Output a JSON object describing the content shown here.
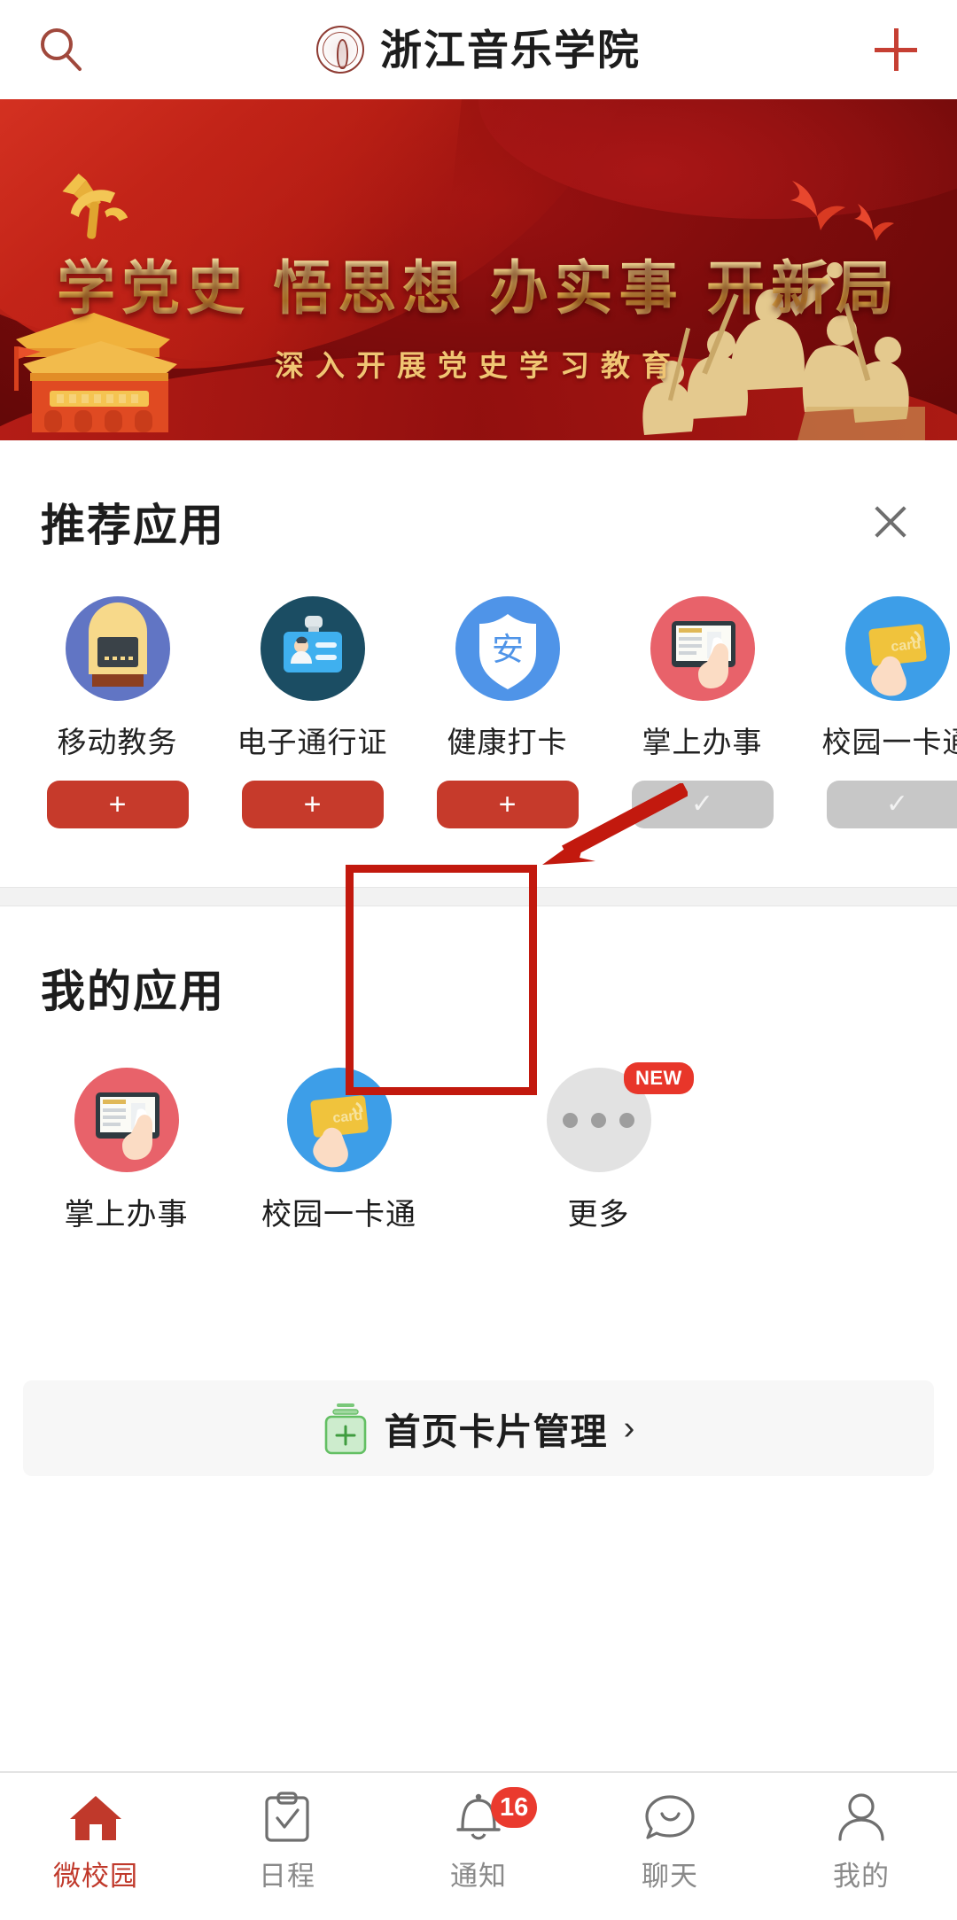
{
  "header": {
    "search_icon": "search-icon",
    "logo_icon": "university-seal-icon",
    "title": "浙江音乐学院",
    "add_icon": "plus-icon"
  },
  "banner": {
    "main_text": "学党史 悟思想 办实事 开新局",
    "sub_text": "深入开展党史学习教育",
    "emblem_icon": "party-emblem-icon",
    "doves_icon": "doves-icon",
    "gate_icon": "tiananmen-gate-icon",
    "figures_icon": "monument-figures-icon",
    "bg_color": "#7e0c0c",
    "text_color": "#f0c573"
  },
  "recommended": {
    "title": "推荐应用",
    "close_icon": "close-icon",
    "apps": [
      {
        "label": "移动教务",
        "icon": "blackboard-icon",
        "action": "+",
        "state": "add"
      },
      {
        "label": "电子通行证",
        "icon": "id-card-icon",
        "action": "+",
        "state": "add"
      },
      {
        "label": "健康打卡",
        "icon": "shield-safe-icon",
        "action": "+",
        "state": "add"
      },
      {
        "label": "掌上办事",
        "icon": "tablet-hand-icon",
        "action": "✓",
        "state": "added"
      },
      {
        "label": "校园一卡通",
        "icon": "campus-card-icon",
        "action": "✓",
        "state": "added"
      }
    ]
  },
  "my_apps": {
    "title": "我的应用",
    "apps": [
      {
        "label": "掌上办事",
        "icon": "tablet-hand-icon",
        "badge": ""
      },
      {
        "label": "校园一卡通",
        "icon": "campus-card-icon",
        "badge": ""
      },
      {
        "label": "更多",
        "icon": "more-dots-icon",
        "badge": "NEW"
      }
    ]
  },
  "annotation": {
    "highlight_color": "#c2190e",
    "arrow_icon": "annotation-arrow-icon",
    "box_icon": "annotation-highlight-box"
  },
  "card_manage": {
    "label": "首页卡片管理",
    "icon": "card-stack-add-icon",
    "chevron": "›",
    "accent_color": "#69c169"
  },
  "tabbar": {
    "active_color": "#c0392b",
    "inactive_color": "#8a8a8a",
    "tabs": [
      {
        "label": "微校园",
        "icon": "home-icon",
        "active": true,
        "badge": ""
      },
      {
        "label": "日程",
        "icon": "clipboard-check-icon",
        "active": false,
        "badge": ""
      },
      {
        "label": "通知",
        "icon": "bell-icon",
        "active": false,
        "badge": "16"
      },
      {
        "label": "聊天",
        "icon": "chat-bubble-icon",
        "active": false,
        "badge": ""
      },
      {
        "label": "我的",
        "icon": "person-icon",
        "active": false,
        "badge": ""
      }
    ]
  }
}
